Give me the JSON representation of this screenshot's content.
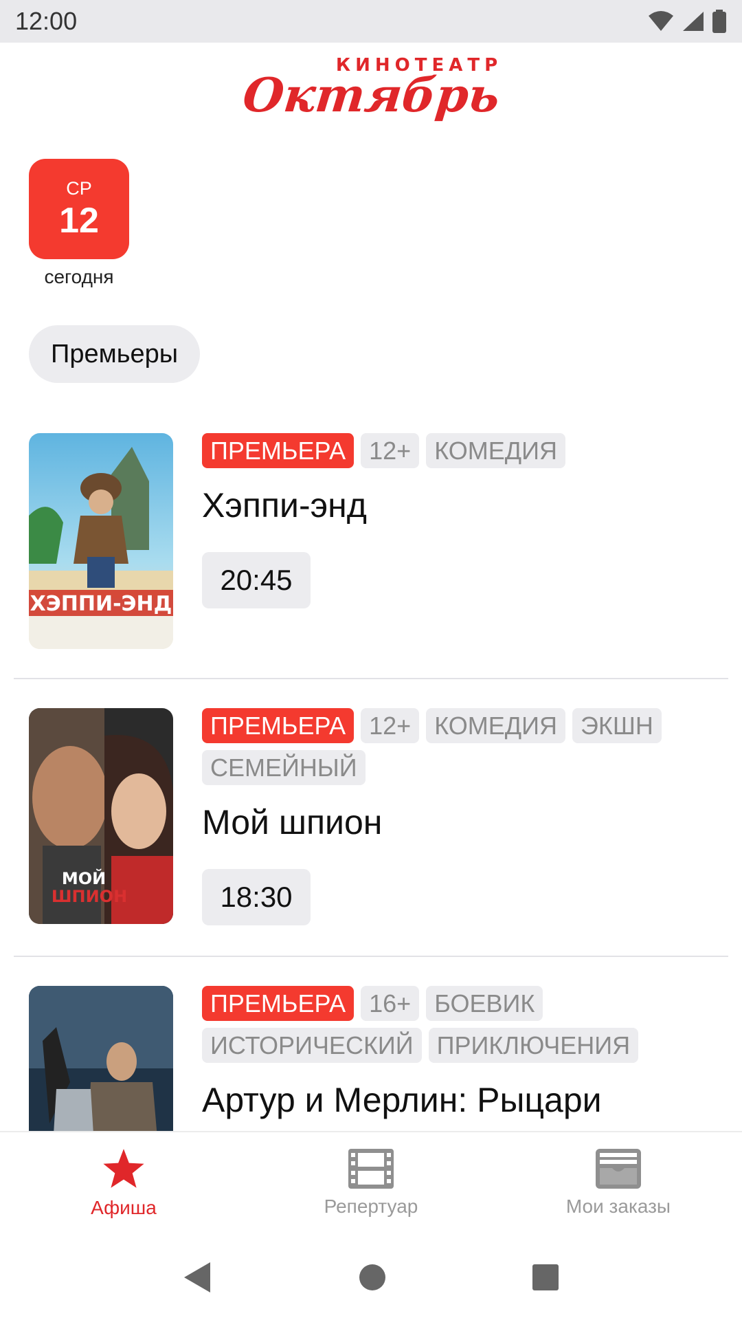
{
  "status_bar": {
    "time": "12:00"
  },
  "header": {
    "logo_top": "КИНОТЕАТР",
    "logo_main": "Октябрь"
  },
  "date_selector": {
    "dow": "СР",
    "day": "12",
    "label": "сегодня"
  },
  "filter_chip": {
    "label": "Премьеры"
  },
  "movies": [
    {
      "tags": [
        "ПРЕМЬЕРА",
        "12+",
        "КОМЕДИЯ"
      ],
      "title": "Хэппи-энд",
      "showtime": "20:45"
    },
    {
      "tags": [
        "ПРЕМЬЕРА",
        "12+",
        "КОМЕДИЯ",
        "ЭКШН",
        "СЕМЕЙНЫЙ"
      ],
      "title": "Мой шпион",
      "showtime": "18:30"
    },
    {
      "tags": [
        "ПРЕМЬЕРА",
        "16+",
        "БОЕВИК",
        "ИСТОРИЧЕСКИЙ",
        "ПРИКЛЮЧЕНИЯ"
      ],
      "title": "Артур и Мерлин: Рыцари"
    }
  ],
  "bottom_nav": {
    "items": [
      {
        "label": "Афиша",
        "icon": "star-icon",
        "active": true
      },
      {
        "label": "Репертуар",
        "icon": "film-icon",
        "active": false
      },
      {
        "label": "Мои заказы",
        "icon": "ticket-box-icon",
        "active": false
      }
    ]
  },
  "colors": {
    "accent": "#f43a2f",
    "brand": "#e0272a",
    "chip_bg": "#ececef",
    "inactive": "#9a9a9a"
  }
}
